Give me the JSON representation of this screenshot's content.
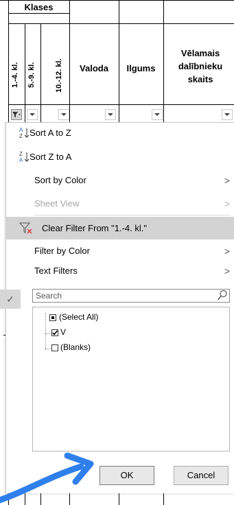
{
  "sheet": {
    "group_header": "Klases",
    "columns": [
      {
        "label": "1.-4. kl."
      },
      {
        "label": "5.-9. kl."
      },
      {
        "label": "10.-12. kl."
      },
      {
        "label": "Valoda"
      },
      {
        "label": "Ilgums"
      },
      {
        "label": "Vēlamais dalībnieku skaits"
      }
    ]
  },
  "menu": {
    "sort_a_to_z": "Sort A to Z",
    "sort_z_to_a": "Sort Z to A",
    "sort_by_color": "Sort by Color",
    "sheet_view": "Sheet View",
    "clear_filter": "Clear Filter From \"1.-4. kl.\"",
    "filter_by_color": "Filter by Color",
    "text_filters": "Text Filters",
    "submenu_arrow": ">"
  },
  "search": {
    "placeholder": "Search"
  },
  "values": [
    {
      "label": "(Select All)",
      "state": "partial"
    },
    {
      "label": "V",
      "state": "checked"
    },
    {
      "label": "(Blanks)",
      "state": "unchecked"
    }
  ],
  "buttons": {
    "ok": "OK",
    "cancel": "Cancel"
  },
  "colors": {
    "highlight": "#d3d3d3",
    "arrow_annotation": "#2f80ed",
    "filter_active": "#d6d6d6"
  }
}
